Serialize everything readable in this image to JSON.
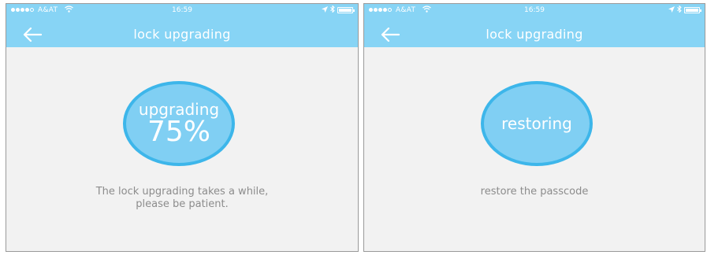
{
  "screens": [
    {
      "status": {
        "carrier": "A&AT",
        "time": "16:59"
      },
      "title": "lock upgrading",
      "circle": {
        "label": "upgrading",
        "percent": "75%",
        "progress": 75
      },
      "message": {
        "line1": "The lock upgrading takes a while,",
        "line2": "please be patient."
      }
    },
    {
      "status": {
        "carrier": "A&AT",
        "time": "16:59"
      },
      "title": "lock upgrading",
      "circle": {
        "label": "restoring"
      },
      "message": {
        "line1": "restore the passcode"
      }
    }
  ],
  "icons": {
    "back": "back-arrow-icon",
    "wifi": "wifi-icon",
    "location": "location-arrow-icon",
    "bluetooth": "bluetooth-icon",
    "battery": "battery-icon"
  },
  "colors": {
    "header": "#87d4f5",
    "circle_fill": "#80cff3",
    "circle_border": "#3db6ea",
    "background": "#f2f2f2",
    "message_text": "#8c8c8c"
  }
}
